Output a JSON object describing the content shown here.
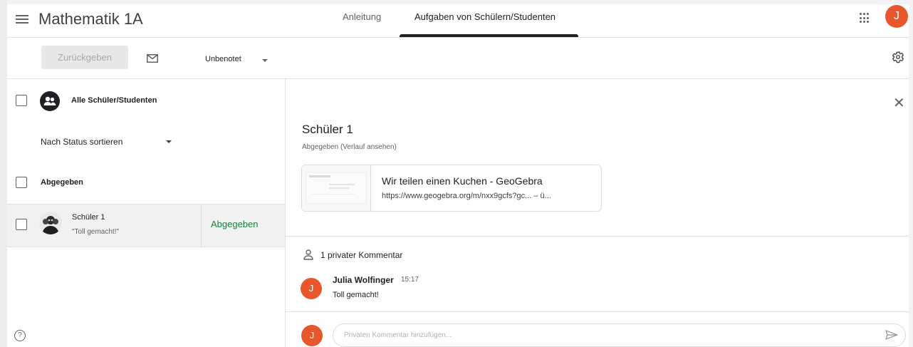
{
  "header": {
    "title": "Mathematik 1A",
    "tabs": [
      {
        "label": "Anleitung",
        "active": false
      },
      {
        "label": "Aufgaben von Schülern/Studenten",
        "active": true
      }
    ],
    "avatar_letter": "J",
    "menu_icon": "hamburger-menu-icon",
    "apps_icon": "apps-grid-icon"
  },
  "toolbar": {
    "return_label": "Zurückgeben",
    "mail_icon": "mail-icon",
    "grade_filter": "Unbenotet",
    "settings_icon": "gear-icon"
  },
  "student_list": {
    "all_label": "Alle Schüler/Studenten",
    "sort_label": "Nach Status sortieren",
    "section_label": "Abgegeben",
    "students": [
      {
        "name": "Schüler 1",
        "comment": "\"Toll gemacht!\"",
        "status": "Abgegeben"
      }
    ],
    "help_icon": "help-icon"
  },
  "detail": {
    "student_name": "Schüler 1",
    "status_text": "Abgegeben (Verlauf ansehen)",
    "attachment": {
      "title": "Wir teilen einen Kuchen - GeoGebra",
      "url": "https://www.geogebra.org/m/nxx9gcfs?gc... – ü..."
    },
    "comments_label": "1 privater Kommentar",
    "comments": [
      {
        "avatar_letter": "J",
        "author": "Julia Wolfinger",
        "time": "15:17",
        "text": "Toll gemacht!"
      }
    ],
    "composer": {
      "avatar_letter": "J",
      "placeholder": "Privaten Kommentar hinzufügen...",
      "send_icon": "send-icon"
    },
    "close_icon": "close-icon"
  },
  "colors": {
    "accent_avatar": "#e8572b",
    "status_green": "#188038",
    "tab_underline": "#202124"
  }
}
